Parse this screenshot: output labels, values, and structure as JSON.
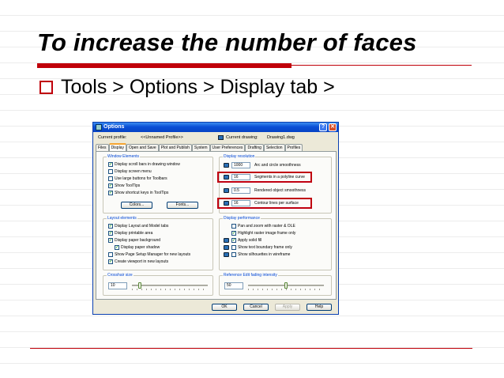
{
  "slide": {
    "title": "To increase the number of faces",
    "bullet": "Tools > Options > Display tab >"
  },
  "dialog": {
    "title": "Options",
    "help_button": "?",
    "close_button": "✕",
    "current_profile_label": "Current profile:",
    "current_profile_value": "<<Unnamed Profile>>",
    "current_drawing_label": "Current drawing:",
    "current_drawing_value": "Drawing1.dwg",
    "tabs": [
      "Files",
      "Display",
      "Open and Save",
      "Plot and Publish",
      "System",
      "User Preferences",
      "Drafting",
      "Selection",
      "Profiles"
    ],
    "active_tab": "Display",
    "window_elements": {
      "label": "Window Elements",
      "items": [
        {
          "label": "Display scroll bars in drawing window",
          "checked": true
        },
        {
          "label": "Display screen menu",
          "checked": false
        },
        {
          "label": "Use large buttons for Toolbars",
          "checked": false
        },
        {
          "label": "Show ToolTips",
          "checked": true
        },
        {
          "label": "Show shortcut keys in ToolTips",
          "checked": true
        }
      ],
      "colors_button": "Colors...",
      "fonts_button": "Fonts..."
    },
    "display_resolution": {
      "label": "Display resolution",
      "items": [
        {
          "value": "1000",
          "label": "Arc and circle smoothness",
          "highlighted": false
        },
        {
          "value": "16",
          "label": "Segments in a polyline curve",
          "highlighted": true
        },
        {
          "value": "0.5",
          "label": "Rendered object smoothness",
          "highlighted": false
        },
        {
          "value": "16",
          "label": "Contour lines per surface",
          "highlighted": true
        }
      ]
    },
    "layout_elements": {
      "label": "Layout elements",
      "items": [
        {
          "label": "Display Layout and Model tabs",
          "checked": true,
          "indent": false
        },
        {
          "label": "Display printable area",
          "checked": true,
          "indent": false
        },
        {
          "label": "Display paper background",
          "checked": true,
          "indent": false
        },
        {
          "label": "Display paper shadow",
          "checked": true,
          "indent": true
        },
        {
          "label": "Show Page Setup Manager for new layouts",
          "checked": false,
          "indent": false
        },
        {
          "label": "Create viewport in new layouts",
          "checked": true,
          "indent": false
        }
      ]
    },
    "display_performance": {
      "label": "Display performance",
      "items": [
        {
          "label": "Pan and zoom with raster & OLE",
          "checked": false,
          "icon": false
        },
        {
          "label": "Highlight raster image frame only",
          "checked": true,
          "icon": false
        },
        {
          "label": "Apply solid fill",
          "checked": true,
          "icon": true
        },
        {
          "label": "Show text boundary frame only",
          "checked": false,
          "icon": true
        },
        {
          "label": "Show silhouettes in wireframe",
          "checked": false,
          "icon": true
        }
      ]
    },
    "crosshair_size": {
      "label": "Crosshair size",
      "value": "10",
      "level": 0.1
    },
    "xref_fading": {
      "label": "Reference Edit fading intensity",
      "value": "50",
      "level": 0.5
    },
    "buttons": {
      "ok": "OK",
      "cancel": "Cancel",
      "apply": "Apply",
      "help": "Help"
    }
  }
}
